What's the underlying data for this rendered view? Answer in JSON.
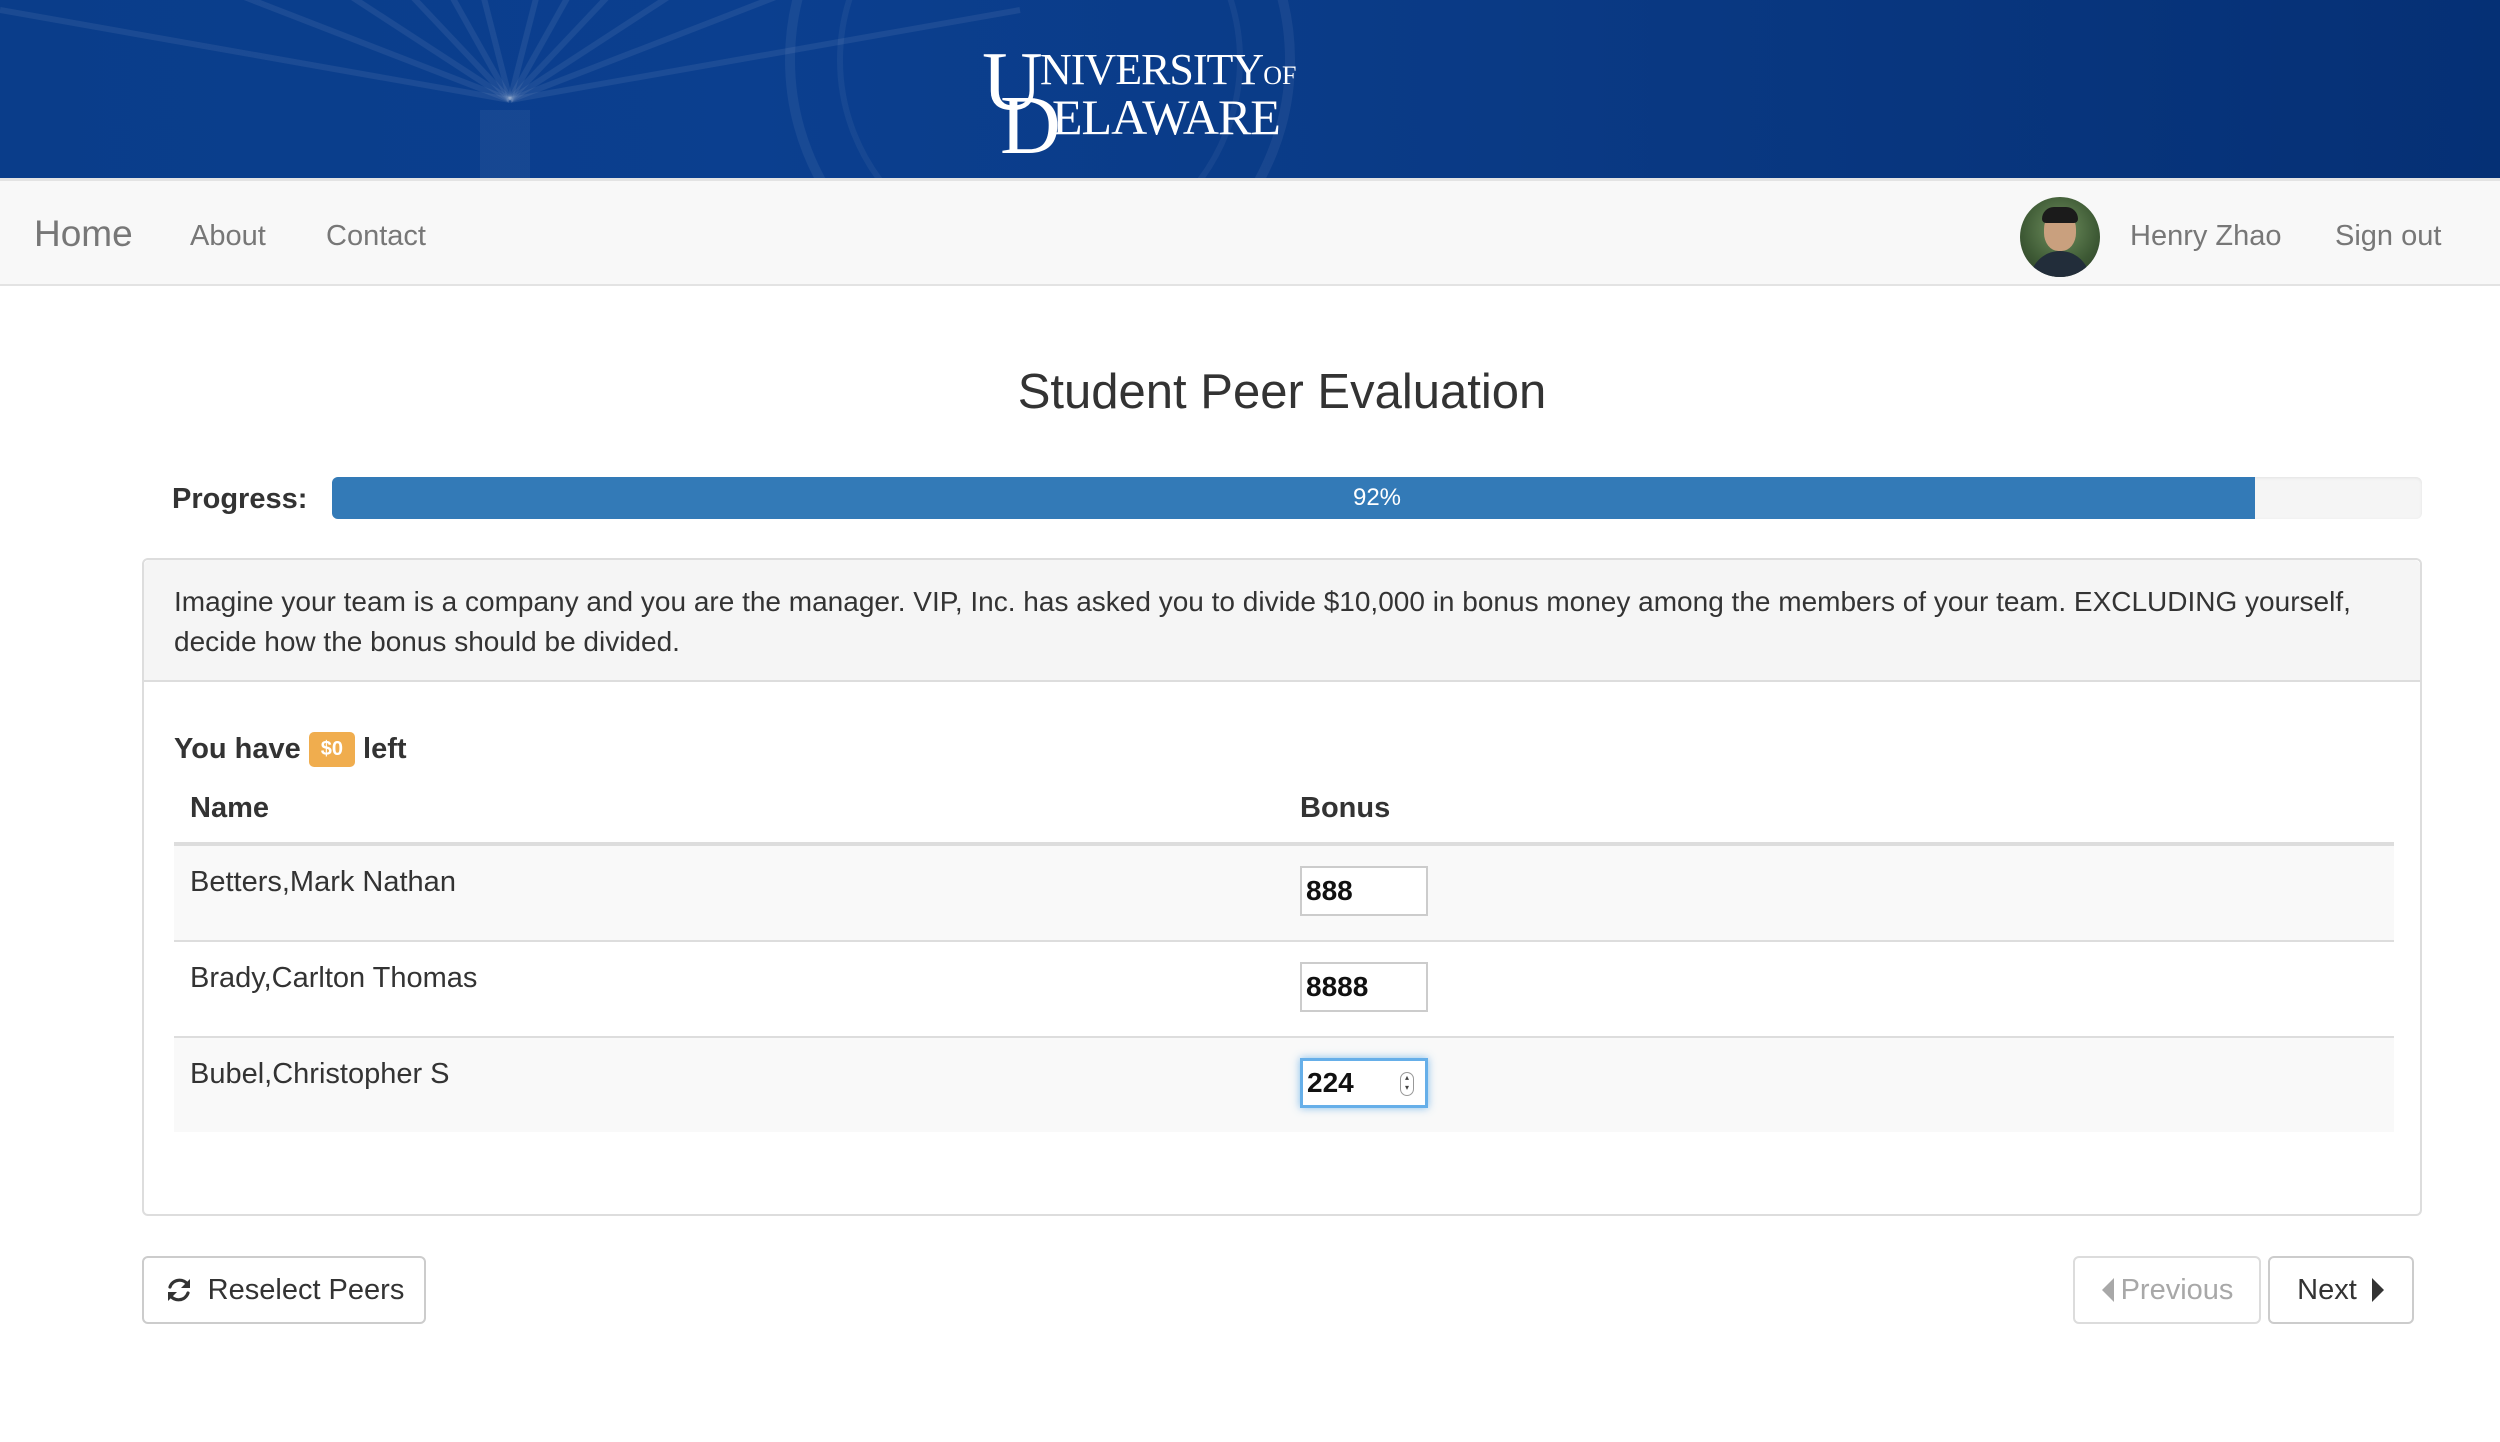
{
  "banner": {
    "logo_line1": "NIVERSITY",
    "logo_of": "OF",
    "logo_line2": "ELAWARE",
    "logo_u": "U",
    "logo_d": "D"
  },
  "navbar": {
    "brand": "Home",
    "links": [
      "About",
      "Contact"
    ],
    "user_name": "Henry Zhao",
    "sign_out": "Sign out"
  },
  "page": {
    "title": "Student Peer Evaluation",
    "progress_label": "Progress:",
    "progress_percent": 92,
    "progress_text": "92%"
  },
  "panel": {
    "instructions": "Imagine your team is a company and you are the manager. VIP, Inc. has asked you to divide $10,000 in bonus money among the members of your team. EXCLUDING yourself, decide how the bonus should be divided.",
    "remaining_prefix": "You have",
    "remaining_amount": "$0",
    "remaining_suffix": "left",
    "columns": [
      "Name",
      "Bonus"
    ],
    "rows": [
      {
        "name": "Betters,Mark Nathan",
        "bonus": "888"
      },
      {
        "name": "Brady,Carlton Thomas",
        "bonus": "8888"
      },
      {
        "name": "Bubel,Christopher S",
        "bonus": "224"
      }
    ]
  },
  "actions": {
    "reselect": "Reselect Peers",
    "previous": "Previous",
    "next": "Next"
  },
  "colors": {
    "banner": "#0a3d8a",
    "progress": "#337ab7",
    "badge": "#f0ad4e",
    "focus": "#66afe9"
  }
}
